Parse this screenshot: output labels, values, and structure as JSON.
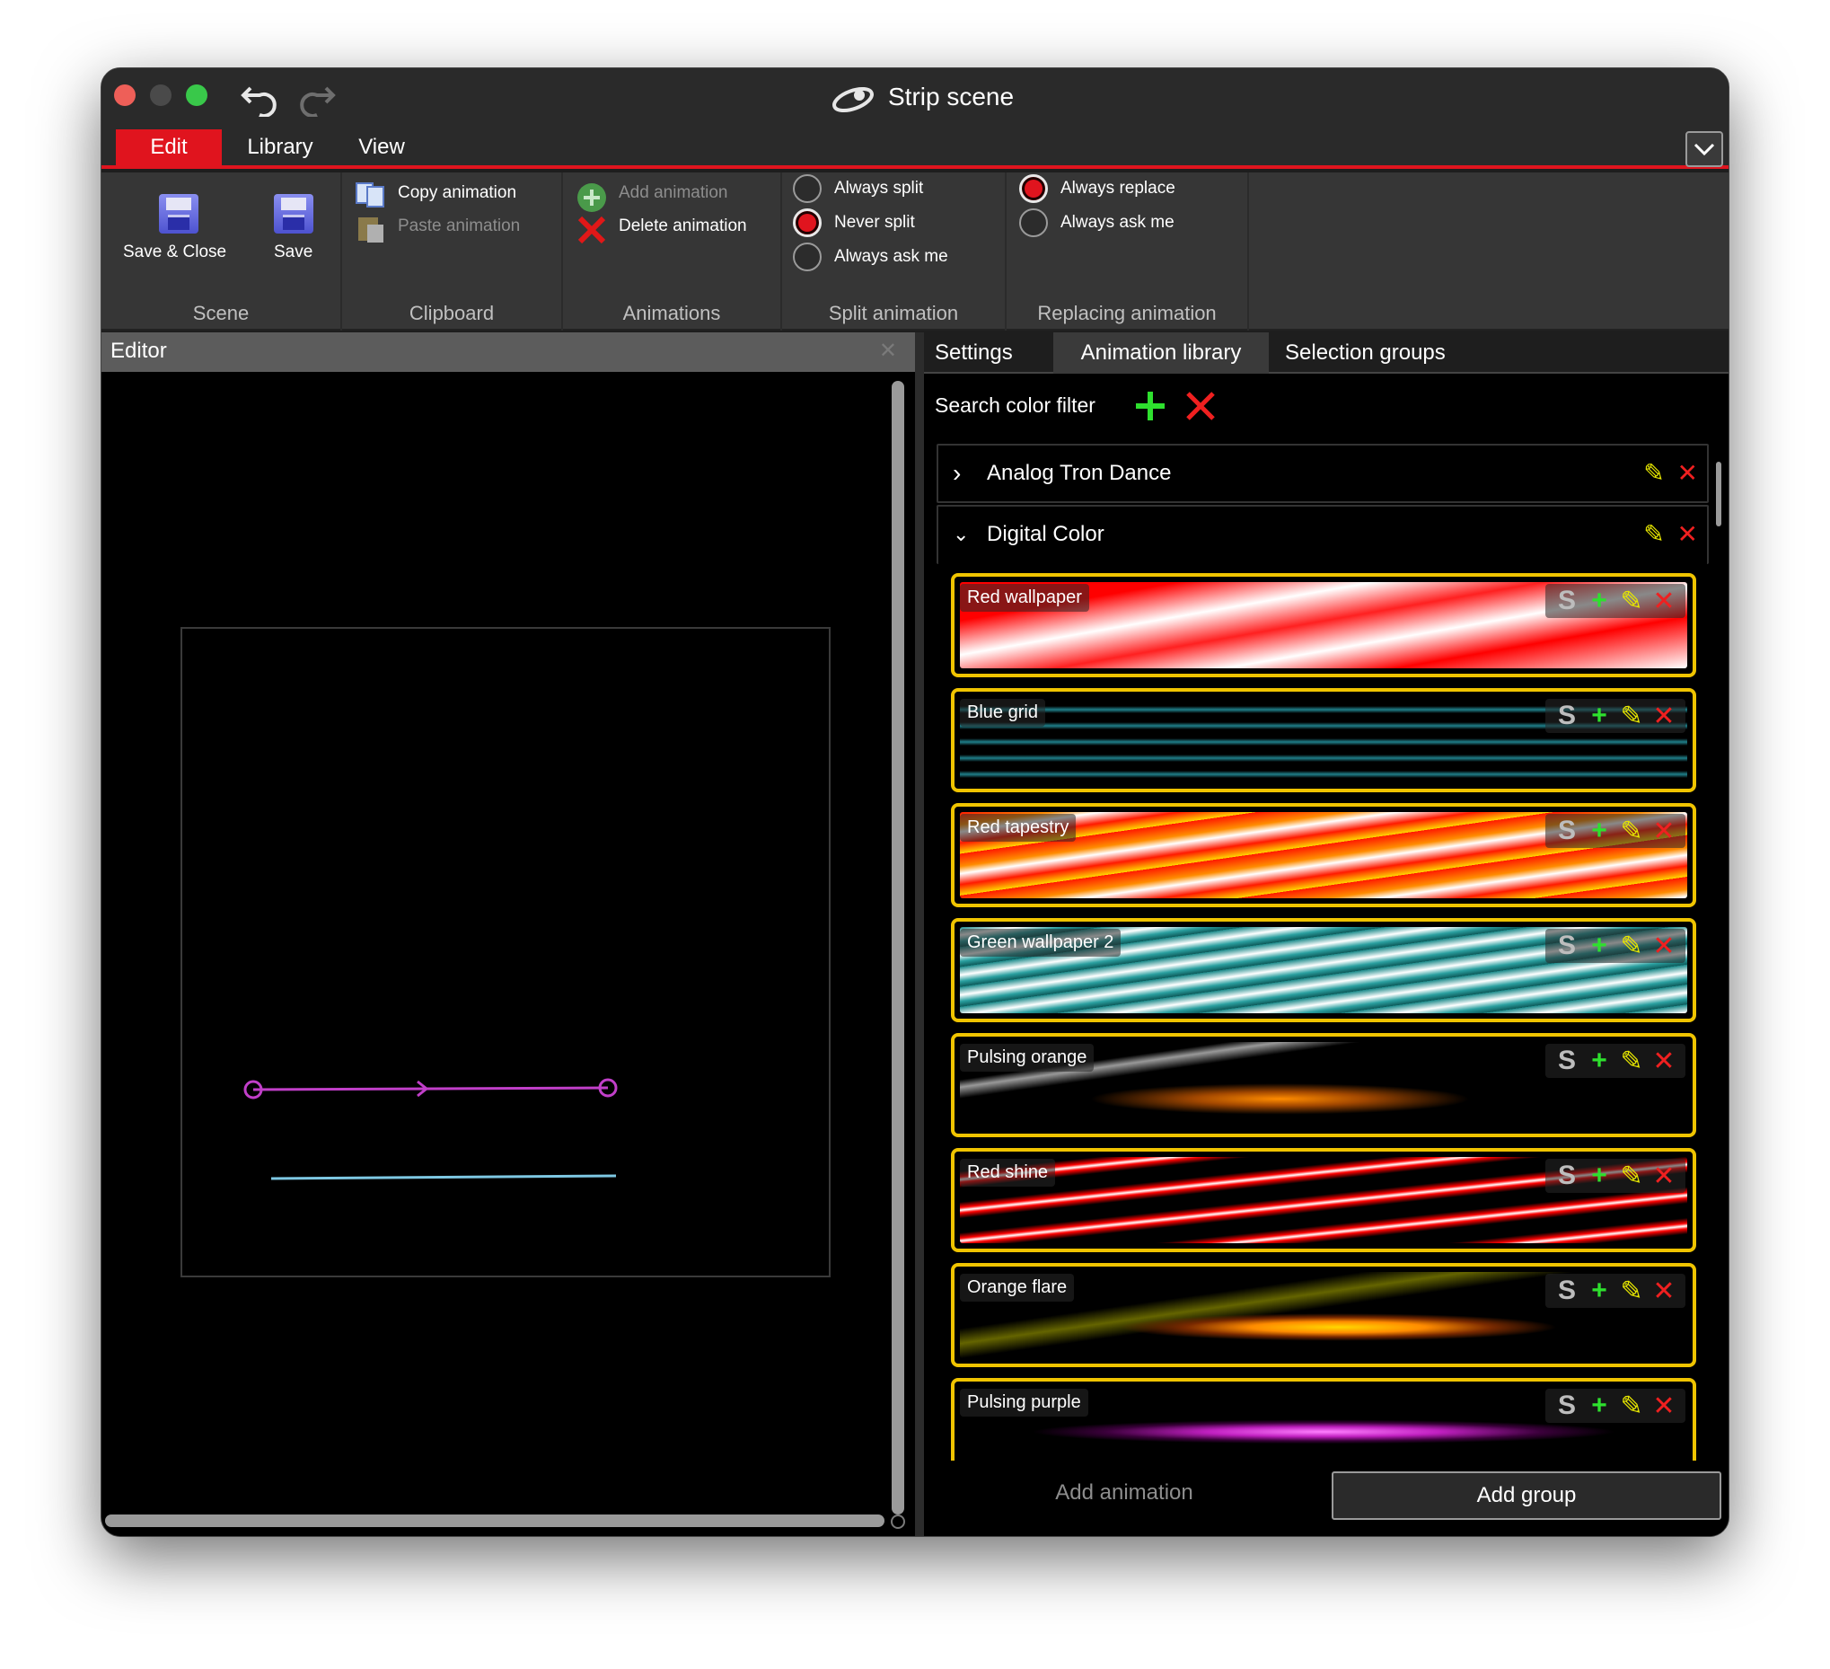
{
  "window": {
    "title": "Strip scene",
    "undo_icon": "undo-icon",
    "redo_icon": "redo-icon",
    "app_logo": "app-logo-icon"
  },
  "menu_tabs": [
    {
      "label": "Edit",
      "active": true
    },
    {
      "label": "Library",
      "active": false
    },
    {
      "label": "View",
      "active": false
    }
  ],
  "ribbon": {
    "scene": {
      "label": "Scene",
      "save_close": "Save & Close",
      "save": "Save"
    },
    "clipboard": {
      "label": "Clipboard",
      "copy": "Copy animation",
      "paste": "Paste animation"
    },
    "animations": {
      "label": "Animations",
      "add": "Add animation",
      "delete": "Delete animation"
    },
    "split": {
      "label": "Split animation",
      "options": [
        {
          "label": "Always split",
          "selected": false
        },
        {
          "label": "Never split",
          "selected": true
        },
        {
          "label": "Always ask me",
          "selected": false
        }
      ]
    },
    "replacing": {
      "label": "Replacing animation",
      "options": [
        {
          "label": "Always replace",
          "selected": true
        },
        {
          "label": "Always ask me",
          "selected": false
        }
      ]
    }
  },
  "editor": {
    "title": "Editor",
    "close_glyph": "✕",
    "segments": [
      {
        "name": "strip-magenta",
        "color": "#c13fc9"
      },
      {
        "name": "strip-cyan",
        "color": "#7ec8e3"
      }
    ]
  },
  "right_tabs": [
    {
      "label": "Settings",
      "active": false
    },
    {
      "label": "Animation library",
      "active": true
    },
    {
      "label": "Selection groups",
      "active": false
    }
  ],
  "filter": {
    "label": "Search color filter"
  },
  "library": {
    "groups": [
      {
        "name": "Analog Tron Dance",
        "expanded": false
      },
      {
        "name": "Digital Color",
        "expanded": true
      }
    ],
    "animations": [
      {
        "name": "Red wallpaper",
        "colors": [
          "#ff0000",
          "#ffffff"
        ]
      },
      {
        "name": "Blue grid",
        "colors": [
          "#000000",
          "#5fd7e6"
        ]
      },
      {
        "name": "Red tapestry",
        "colors": [
          "#ff1a00",
          "#ffd700"
        ]
      },
      {
        "name": "Green wallpaper 2",
        "colors": [
          "#1a8a8a",
          "#ffffff"
        ]
      },
      {
        "name": "Pulsing orange",
        "colors": [
          "#000000",
          "#ff8c00"
        ]
      },
      {
        "name": "Red shine",
        "colors": [
          "#000000",
          "#ff0000"
        ]
      },
      {
        "name": "Orange flare",
        "colors": [
          "#000000",
          "#ffb400"
        ]
      },
      {
        "name": "Pulsing purple",
        "colors": [
          "#000000",
          "#c020c0"
        ]
      }
    ],
    "card_actions": {
      "s": "S",
      "add": "+",
      "edit": "✎",
      "delete": "✕"
    }
  },
  "footer": {
    "add_animation": "Add animation",
    "add_group": "Add group"
  },
  "colors": {
    "accent_red": "#e0141e",
    "card_border": "#f0c400",
    "add_green": "#2ee02e",
    "edit_yellow": "#e6e600",
    "delete_red": "#f02020"
  }
}
